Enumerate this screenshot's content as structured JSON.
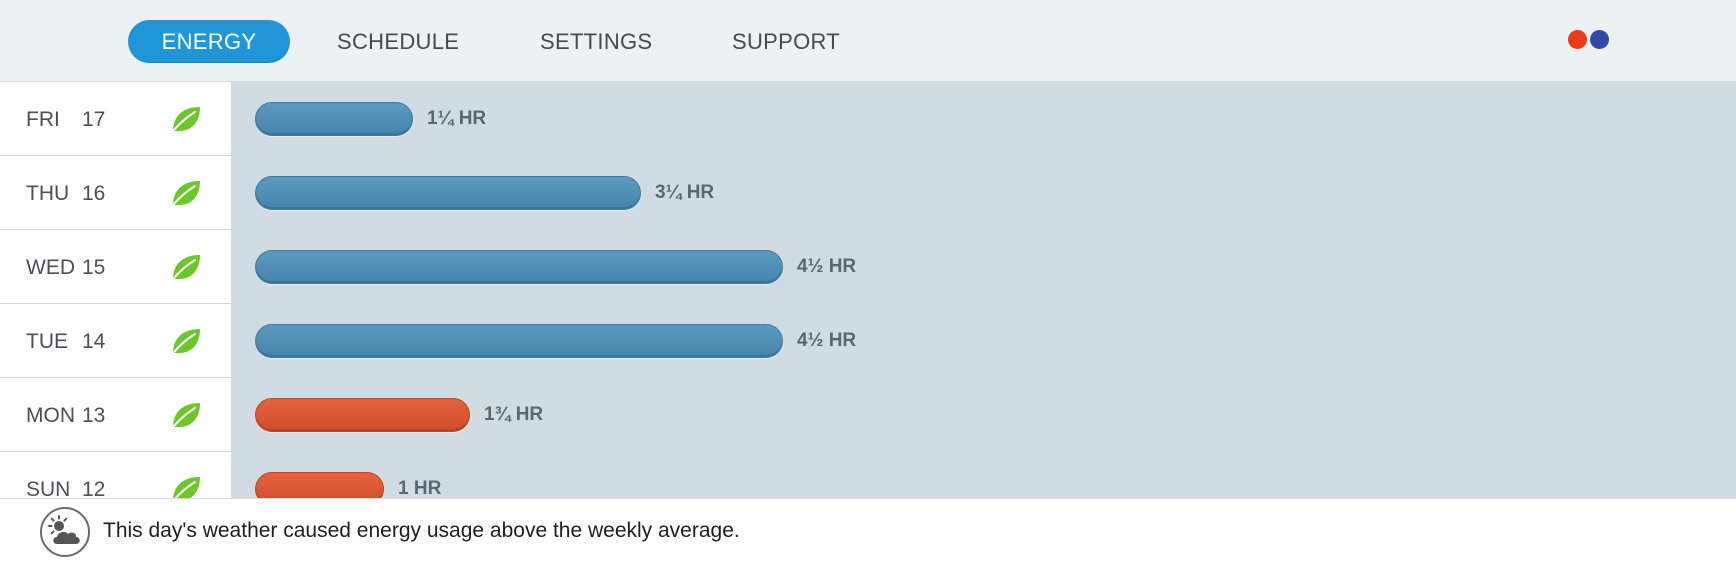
{
  "nav": {
    "tabs": [
      {
        "label": "ENERGY",
        "active": true
      },
      {
        "label": "SCHEDULE",
        "active": false
      },
      {
        "label": "SETTINGS",
        "active": false
      },
      {
        "label": "SUPPORT",
        "active": false
      }
    ],
    "status_dots": [
      "#ef3a16",
      "#3549a8"
    ]
  },
  "colors": {
    "leaf": "#6dc62b",
    "bar_blue": "#4c8bb4",
    "bar_orange": "#d95632",
    "icon_gray": "#555555"
  },
  "days": [
    {
      "day": "FRI",
      "date": "17",
      "usage": "1¼ HR",
      "hours": 1.25,
      "bar_color": "blue",
      "badge": "away-icon"
    },
    {
      "day": "THU",
      "date": "16",
      "usage": "3¼ HR",
      "hours": 3.25,
      "bar_color": "blue",
      "badge": ""
    },
    {
      "day": "WED",
      "date": "15",
      "usage": "4½ HR",
      "hours": 4.5,
      "bar_color": "blue",
      "badge": "weather-icon"
    },
    {
      "day": "TUE",
      "date": "14",
      "usage": "4½ HR",
      "hours": 4.5,
      "bar_color": "blue",
      "badge": "weather-icon"
    },
    {
      "day": "MON",
      "date": "13",
      "usage": "1¾ HR",
      "hours": 1.75,
      "bar_color": "orange",
      "badge": "user-icon"
    },
    {
      "day": "SUN",
      "date": "12",
      "usage": "1 HR",
      "hours": 1,
      "bar_color": "orange",
      "badge": "weather-icon"
    }
  ],
  "footer": {
    "icon": "weather-icon",
    "message": "This day's weather caused energy usage above the weekly average."
  }
}
